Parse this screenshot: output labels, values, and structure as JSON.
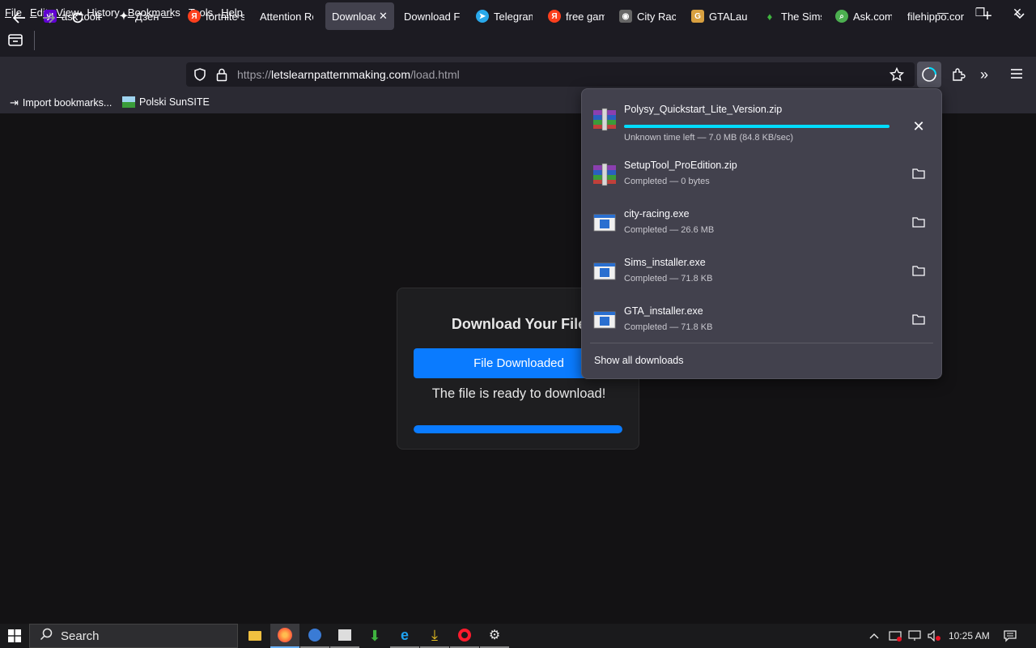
{
  "menu": {
    "items": [
      "File",
      "Edit",
      "View",
      "History",
      "Bookmarks",
      "Tools",
      "Help"
    ],
    "accesskeys": [
      "F",
      "E",
      "V",
      "s",
      "B",
      "T",
      "H"
    ]
  },
  "window_controls": {
    "minimize": "—",
    "restore": "❐",
    "close": "✕"
  },
  "tabs": [
    {
      "label": "ask toolb",
      "icon": "yahoo-icon",
      "color": "#6001d2"
    },
    {
      "label": "Дзен —",
      "icon": "dzen-icon",
      "color": "#1c1b22"
    },
    {
      "label": "fortnite s",
      "icon": "yandex-icon",
      "color": "#fc3f1d"
    },
    {
      "label": "Attention Re",
      "icon": "",
      "color": ""
    },
    {
      "label": "Downloac",
      "icon": "",
      "color": "",
      "active": true
    },
    {
      "label": "Download Fi",
      "icon": "",
      "color": ""
    },
    {
      "label": "Telegram",
      "icon": "telegram-icon",
      "color": "#29a9eb"
    },
    {
      "label": "free gam",
      "icon": "yandex-icon",
      "color": "#fc3f1d"
    },
    {
      "label": "City Raci",
      "icon": "game-icon",
      "color": "#888888"
    },
    {
      "label": "GTALaun",
      "icon": "gta-icon",
      "color": "#d8a040"
    },
    {
      "label": "The Sims",
      "icon": "sims-plumbob-icon",
      "color": "#3fb33f"
    },
    {
      "label": "Ask.com",
      "icon": "ask-search-icon",
      "color": "#4caf50"
    },
    {
      "label": "filehippo.con",
      "icon": "",
      "color": ""
    }
  ],
  "url": {
    "prefix": "https://",
    "domain": "letslearnpatternmaking.com",
    "path": "/load.html"
  },
  "bookmarks": [
    {
      "label": "Import bookmarks...",
      "icon": "import-icon"
    },
    {
      "label": "Polski SunSITE",
      "icon": "site-icon"
    }
  ],
  "page": {
    "title": "Download Your File",
    "button": "File Downloaded",
    "message": "The file is ready to download!",
    "progress": 1.0
  },
  "downloads": {
    "items": [
      {
        "name": "Polysy_Quickstart_Lite_Version.zip",
        "status": "Unknown time left — 7.0 MB (84.8 KB/sec)",
        "type": "archive",
        "in_progress": true,
        "progress": 1.0
      },
      {
        "name": "SetupTool_ProEdition.zip",
        "status": "Completed — 0 bytes",
        "type": "archive"
      },
      {
        "name": "city-racing.exe",
        "status": "Completed — 26.6 MB",
        "type": "exe"
      },
      {
        "name": "Sims_installer.exe",
        "status": "Completed — 71.8 KB",
        "type": "exe"
      },
      {
        "name": "GTA_installer.exe",
        "status": "Completed — 71.8 KB",
        "type": "exe"
      }
    ],
    "show_all": "Show all downloads"
  },
  "taskbar": {
    "search_label": "Search",
    "time": "10:25 AM",
    "apps": [
      {
        "name": "file-explorer",
        "color": "#f0c040"
      },
      {
        "name": "firefox",
        "color": "#ff7139",
        "active": true
      },
      {
        "name": "browser",
        "color": "#3a7bd5"
      },
      {
        "name": "app",
        "color": "#cccccc"
      },
      {
        "name": "download-manager",
        "color": "#3fb33f"
      },
      {
        "name": "internet-explorer",
        "color": "#1ea2f0"
      },
      {
        "name": "installer",
        "color": "#e8c020"
      },
      {
        "name": "opera",
        "color": "#ff1b2d"
      },
      {
        "name": "settings",
        "color": "#e8e8e8"
      }
    ]
  }
}
